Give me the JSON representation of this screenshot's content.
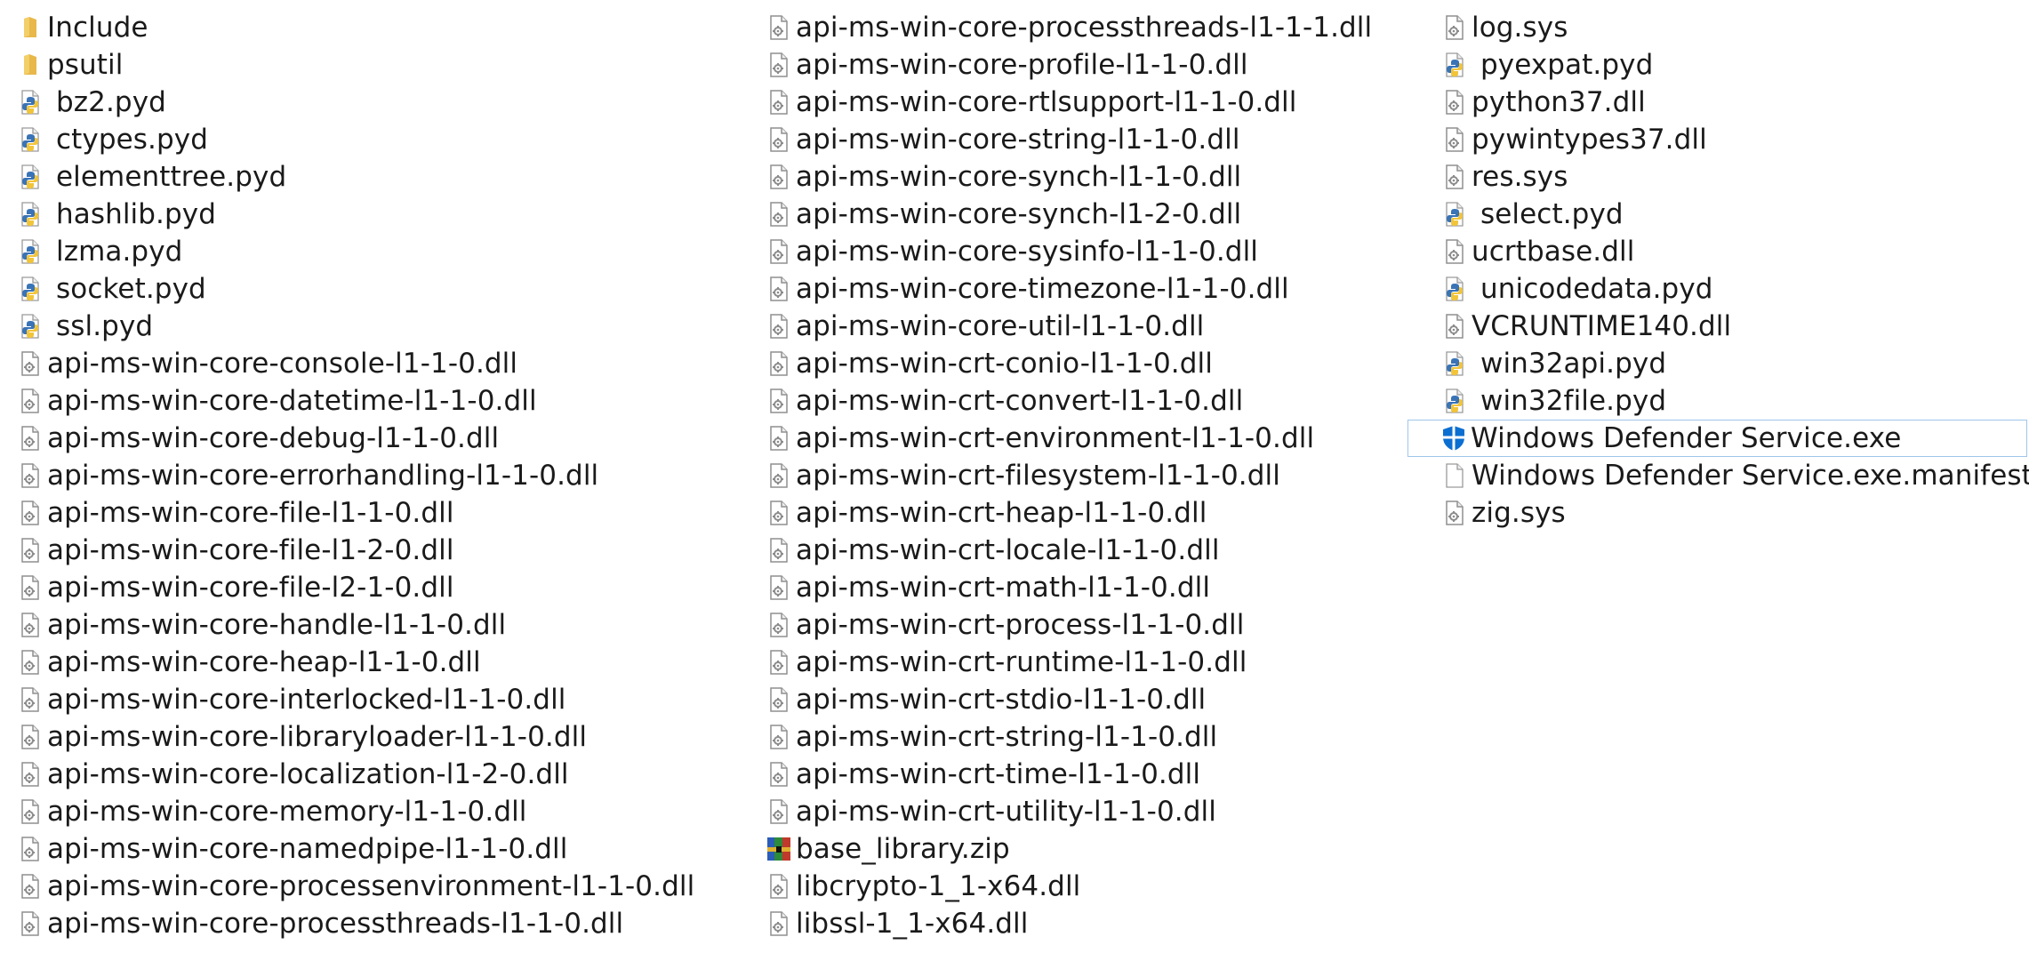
{
  "columns": [
    {
      "items": [
        {
          "name": "Include",
          "type": "folder"
        },
        {
          "name": "psutil",
          "type": "folder"
        },
        {
          "name": "bz2.pyd",
          "type": "py"
        },
        {
          "name": "ctypes.pyd",
          "type": "py"
        },
        {
          "name": "elementtree.pyd",
          "type": "py"
        },
        {
          "name": "hashlib.pyd",
          "type": "py"
        },
        {
          "name": "lzma.pyd",
          "type": "py"
        },
        {
          "name": "socket.pyd",
          "type": "py"
        },
        {
          "name": "ssl.pyd",
          "type": "py"
        },
        {
          "name": "api-ms-win-core-console-l1-1-0.dll",
          "type": "dll"
        },
        {
          "name": "api-ms-win-core-datetime-l1-1-0.dll",
          "type": "dll"
        },
        {
          "name": "api-ms-win-core-debug-l1-1-0.dll",
          "type": "dll"
        },
        {
          "name": "api-ms-win-core-errorhandling-l1-1-0.dll",
          "type": "dll"
        },
        {
          "name": "api-ms-win-core-file-l1-1-0.dll",
          "type": "dll"
        },
        {
          "name": "api-ms-win-core-file-l1-2-0.dll",
          "type": "dll"
        },
        {
          "name": "api-ms-win-core-file-l2-1-0.dll",
          "type": "dll"
        },
        {
          "name": "api-ms-win-core-handle-l1-1-0.dll",
          "type": "dll"
        },
        {
          "name": "api-ms-win-core-heap-l1-1-0.dll",
          "type": "dll"
        },
        {
          "name": "api-ms-win-core-interlocked-l1-1-0.dll",
          "type": "dll"
        },
        {
          "name": "api-ms-win-core-libraryloader-l1-1-0.dll",
          "type": "dll"
        },
        {
          "name": "api-ms-win-core-localization-l1-2-0.dll",
          "type": "dll"
        },
        {
          "name": "api-ms-win-core-memory-l1-1-0.dll",
          "type": "dll"
        },
        {
          "name": "api-ms-win-core-namedpipe-l1-1-0.dll",
          "type": "dll"
        },
        {
          "name": "api-ms-win-core-processenvironment-l1-1-0.dll",
          "type": "dll"
        },
        {
          "name": "api-ms-win-core-processthreads-l1-1-0.dll",
          "type": "dll"
        }
      ]
    },
    {
      "items": [
        {
          "name": "api-ms-win-core-processthreads-l1-1-1.dll",
          "type": "dll"
        },
        {
          "name": "api-ms-win-core-profile-l1-1-0.dll",
          "type": "dll"
        },
        {
          "name": "api-ms-win-core-rtlsupport-l1-1-0.dll",
          "type": "dll"
        },
        {
          "name": "api-ms-win-core-string-l1-1-0.dll",
          "type": "dll"
        },
        {
          "name": "api-ms-win-core-synch-l1-1-0.dll",
          "type": "dll"
        },
        {
          "name": "api-ms-win-core-synch-l1-2-0.dll",
          "type": "dll"
        },
        {
          "name": "api-ms-win-core-sysinfo-l1-1-0.dll",
          "type": "dll"
        },
        {
          "name": "api-ms-win-core-timezone-l1-1-0.dll",
          "type": "dll"
        },
        {
          "name": "api-ms-win-core-util-l1-1-0.dll",
          "type": "dll"
        },
        {
          "name": "api-ms-win-crt-conio-l1-1-0.dll",
          "type": "dll"
        },
        {
          "name": "api-ms-win-crt-convert-l1-1-0.dll",
          "type": "dll"
        },
        {
          "name": "api-ms-win-crt-environment-l1-1-0.dll",
          "type": "dll"
        },
        {
          "name": "api-ms-win-crt-filesystem-l1-1-0.dll",
          "type": "dll"
        },
        {
          "name": "api-ms-win-crt-heap-l1-1-0.dll",
          "type": "dll"
        },
        {
          "name": "api-ms-win-crt-locale-l1-1-0.dll",
          "type": "dll"
        },
        {
          "name": "api-ms-win-crt-math-l1-1-0.dll",
          "type": "dll"
        },
        {
          "name": "api-ms-win-crt-process-l1-1-0.dll",
          "type": "dll"
        },
        {
          "name": "api-ms-win-crt-runtime-l1-1-0.dll",
          "type": "dll"
        },
        {
          "name": "api-ms-win-crt-stdio-l1-1-0.dll",
          "type": "dll"
        },
        {
          "name": "api-ms-win-crt-string-l1-1-0.dll",
          "type": "dll"
        },
        {
          "name": "api-ms-win-crt-time-l1-1-0.dll",
          "type": "dll"
        },
        {
          "name": "api-ms-win-crt-utility-l1-1-0.dll",
          "type": "dll"
        },
        {
          "name": "base_library.zip",
          "type": "zip"
        },
        {
          "name": "libcrypto-1_1-x64.dll",
          "type": "dll"
        },
        {
          "name": "libssl-1_1-x64.dll",
          "type": "dll"
        }
      ]
    },
    {
      "items": [
        {
          "name": "log.sys",
          "type": "dll"
        },
        {
          "name": "pyexpat.pyd",
          "type": "py"
        },
        {
          "name": "python37.dll",
          "type": "dll"
        },
        {
          "name": "pywintypes37.dll",
          "type": "dll"
        },
        {
          "name": "res.sys",
          "type": "dll"
        },
        {
          "name": "select.pyd",
          "type": "py"
        },
        {
          "name": "ucrtbase.dll",
          "type": "dll"
        },
        {
          "name": "unicodedata.pyd",
          "type": "py"
        },
        {
          "name": "VCRUNTIME140.dll",
          "type": "dll"
        },
        {
          "name": "win32api.pyd",
          "type": "py"
        },
        {
          "name": "win32file.pyd",
          "type": "py"
        },
        {
          "name": "Windows Defender Service.exe",
          "type": "shield",
          "selected": true
        },
        {
          "name": "Windows Defender Service.exe.manifest",
          "type": "blank"
        },
        {
          "name": "zig.sys",
          "type": "dll"
        }
      ]
    }
  ],
  "colors": {
    "selection_border": "#9fc6ea",
    "folder": "#e8b84a",
    "shield": "#0b6fd1",
    "python_blue": "#3a73b6",
    "python_yellow": "#f2c43a"
  }
}
